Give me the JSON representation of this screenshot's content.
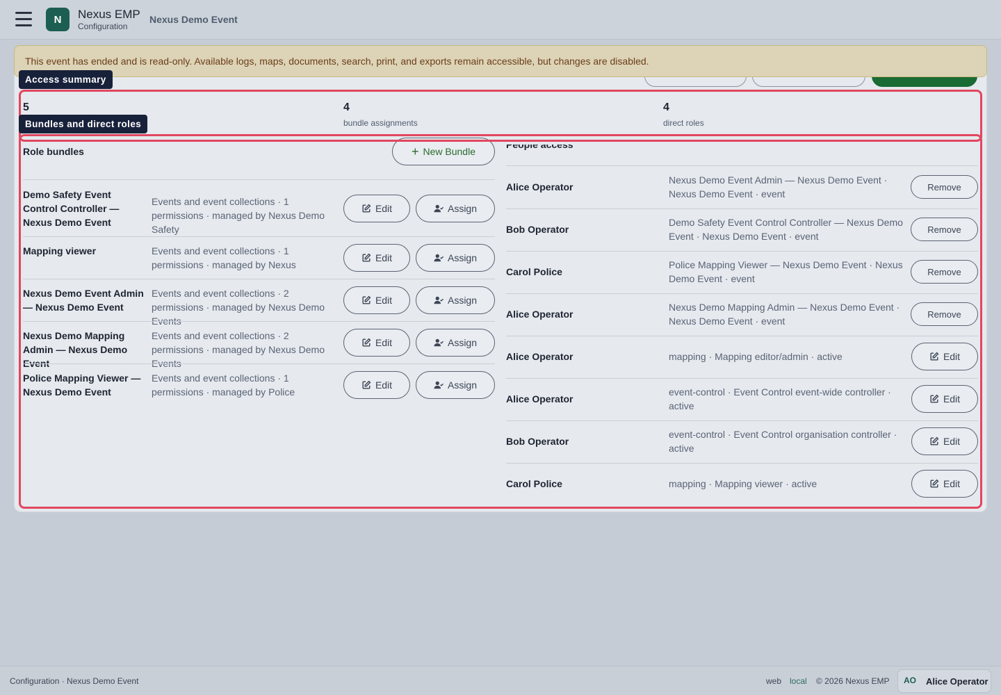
{
  "header": {
    "logo_letter": "N",
    "app_name": "Nexus EMP",
    "app_sub": "Configuration",
    "event_name": "Nexus Demo Event"
  },
  "banner": {
    "text": "This event has ended and is read-only. Available logs, maps, documents, search, print, and exports remain accessible, but changes are disabled."
  },
  "tags": {
    "access_summary": "Access summary",
    "bundles_roles": "Bundles and direct roles"
  },
  "stats": [
    {
      "value": "5",
      "label": ""
    },
    {
      "value": "4",
      "label": "bundle assignments"
    },
    {
      "value": "4",
      "label": "direct roles"
    }
  ],
  "bundles": {
    "title": "Role bundles",
    "new_label": "New Bundle",
    "edit_label": "Edit",
    "assign_label": "Assign",
    "rows": [
      {
        "name": "Demo Safety Event Control Controller — Nexus Demo Event",
        "desc": "Events and event collections · 1 permissions · managed by Nexus Demo Safety"
      },
      {
        "name": "Mapping viewer",
        "desc": "Events and event collections · 1 permissions · managed by Nexus"
      },
      {
        "name": "Nexus Demo Event Admin — Nexus Demo Event",
        "desc": "Events and event collections · 2 permissions · managed by Nexus Demo Events"
      },
      {
        "name": "Nexus Demo Mapping Admin — Nexus Demo Event",
        "desc": "Events and event collections · 2 permissions · managed by Nexus Demo Events"
      },
      {
        "name": "Police Mapping Viewer — Nexus Demo Event",
        "desc": "Events and event collections · 1 permissions · managed by Police"
      }
    ]
  },
  "people": {
    "title": "People access",
    "rows": [
      {
        "person": "Alice Operator",
        "desc": "Nexus Demo Event Admin — Nexus Demo Event · Nexus Demo Event · event",
        "action": "Remove"
      },
      {
        "person": "Bob Operator",
        "desc": "Demo Safety Event Control Controller — Nexus Demo Event · Nexus Demo Event · event",
        "action": "Remove"
      },
      {
        "person": "Carol Police",
        "desc": "Police Mapping Viewer — Nexus Demo Event · Nexus Demo Event · event",
        "action": "Remove"
      },
      {
        "person": "Alice Operator",
        "desc": "Nexus Demo Mapping Admin — Nexus Demo Event · Nexus Demo Event · event",
        "action": "Remove"
      },
      {
        "person": "Alice Operator",
        "desc": "mapping · Mapping editor/admin · active",
        "action": "Edit"
      },
      {
        "person": "Alice Operator",
        "desc": "event-control · Event Control event-wide controller · active",
        "action": "Edit"
      },
      {
        "person": "Bob Operator",
        "desc": "event-control · Event Control organisation controller · active",
        "action": "Edit"
      },
      {
        "person": "Carol Police",
        "desc": "mapping · Mapping viewer · active",
        "action": "Edit"
      }
    ]
  },
  "footer": {
    "left": "Configuration · Nexus Demo Event",
    "web": "web",
    "local": "local",
    "copyright": "© 2026 Nexus EMP",
    "avatar": "AO",
    "user": "Alice Operator"
  }
}
